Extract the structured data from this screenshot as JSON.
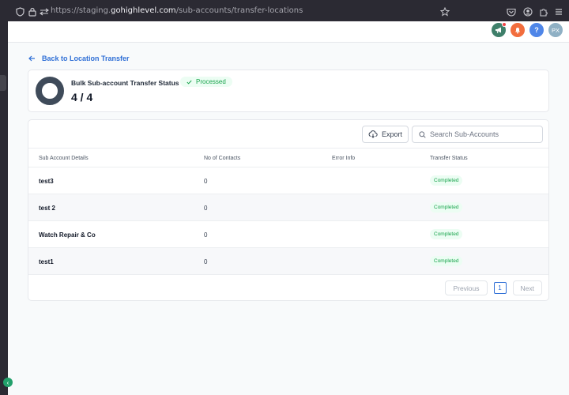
{
  "browser": {
    "url_prefix": "https://staging.",
    "url_host": "gohighlevel.com",
    "url_path": "/sub-accounts/transfer-locations"
  },
  "header": {
    "avatar_initials": "PX",
    "help_label": "?"
  },
  "back_link": {
    "label": "Back to Location Transfer"
  },
  "status": {
    "title": "Bulk Sub-account Transfer Status",
    "badge": "Processed",
    "count": "4 / 4"
  },
  "toolbar": {
    "export_label": "Export",
    "search_placeholder": "Search Sub-Accounts"
  },
  "table": {
    "columns": [
      "Sub Account Details",
      "No of Contacts",
      "Error Info",
      "Transfer Status"
    ],
    "rows": [
      {
        "name": "test3",
        "contacts": "0",
        "error": "",
        "status": "Completed"
      },
      {
        "name": "test 2",
        "contacts": "0",
        "error": "",
        "status": "Completed"
      },
      {
        "name": "Watch Repair & Co",
        "contacts": "0",
        "error": "",
        "status": "Completed"
      },
      {
        "name": "test1",
        "contacts": "0",
        "error": "",
        "status": "Completed"
      }
    ]
  },
  "pagination": {
    "previous_label": "Previous",
    "current_page": "1",
    "next_label": "Next"
  },
  "colors": {
    "accent": "#2f6fd6",
    "success": "#16a34a",
    "announce": "#3f7f6a",
    "bell": "#f26d3d",
    "help": "#4f86e8",
    "avatar": "#8fb0c4"
  }
}
